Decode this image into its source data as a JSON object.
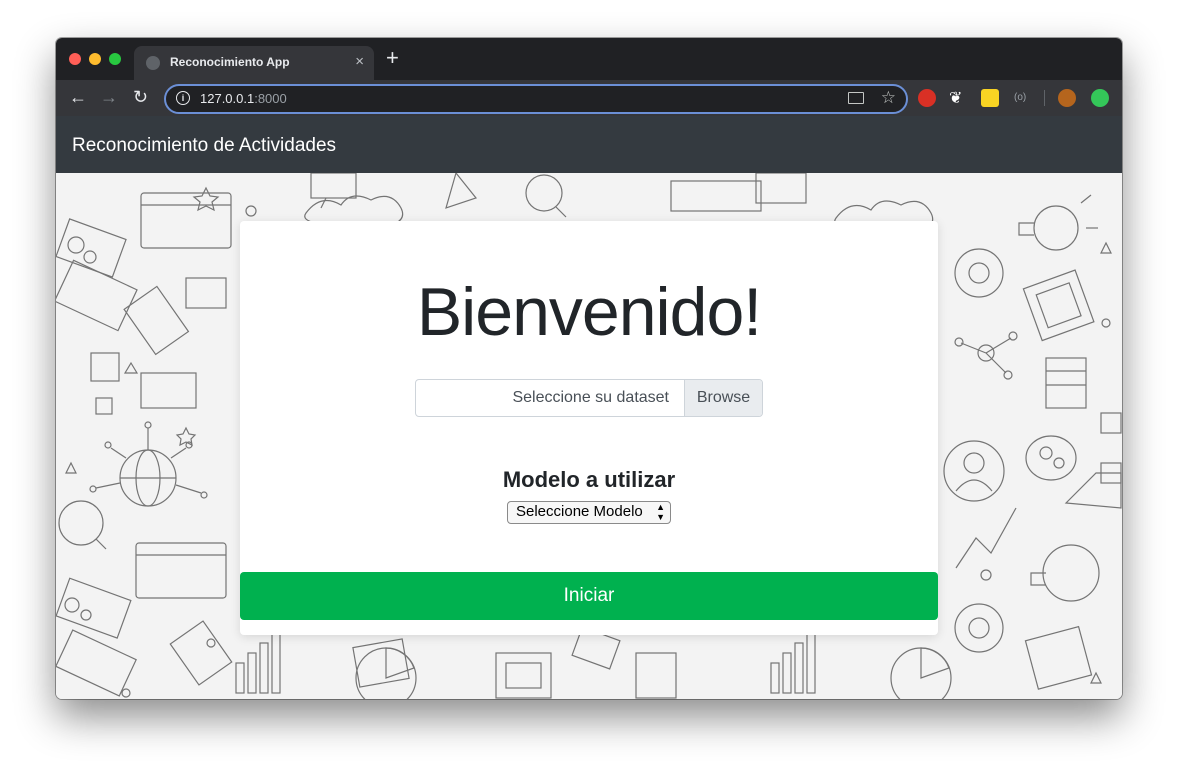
{
  "browser": {
    "tab_title": "Reconocimiento App",
    "new_tab_symbol": "+",
    "close_symbol": "×",
    "url_host": "127.0.0.1",
    "url_port": ":8000",
    "icons": [
      "back-arrow-icon",
      "forward-arrow-icon",
      "reload-icon",
      "info-icon",
      "cast-icon",
      "star-icon"
    ],
    "extensions": [
      "adblock-icon",
      "paw-icon",
      "emoji-icon",
      "code-icon",
      "avatar-icon",
      "update-icon"
    ]
  },
  "navbar": {
    "brand": "Reconocimiento de Actividades",
    "background": "#343a40"
  },
  "card": {
    "headline": "Bienvenido!",
    "file_input": {
      "placeholder": "Seleccione su dataset",
      "button": "Browse"
    },
    "model_heading": "Modelo a utilizar",
    "model_select": {
      "selected": "Seleccione Modelo"
    },
    "start_button": "Iniciar",
    "start_button_color": "#00b14f"
  }
}
